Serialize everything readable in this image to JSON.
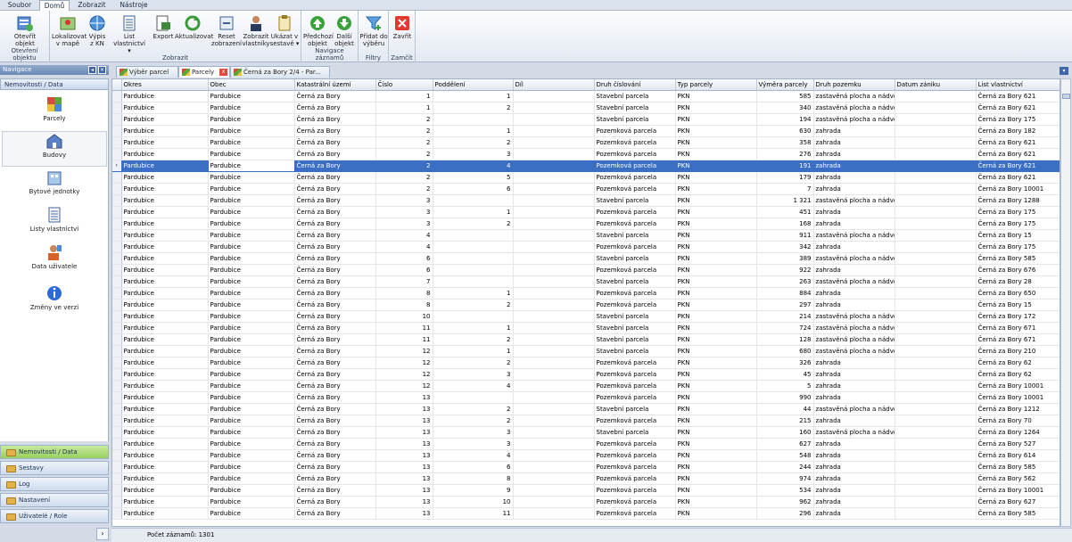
{
  "menu": {
    "tabs": [
      "Soubor",
      "Domů",
      "Zobrazit",
      "Nástroje"
    ],
    "active": 1
  },
  "ribbon": {
    "groups": [
      {
        "label": "Otevření objektu"
      },
      {
        "label": "Zobrazit"
      },
      {
        "label": "Navigace záznamů"
      },
      {
        "label": "Filtry"
      },
      {
        "label": "Zamčít"
      }
    ],
    "buttons": [
      {
        "line1": "Otevřít",
        "line2": "objekt",
        "icon": "open-object-icon"
      },
      {
        "line1": "Lokalizovat",
        "line2": "v mapě",
        "icon": "map-locate-icon"
      },
      {
        "line1": "Výpis",
        "line2": "z KN",
        "icon": "globe-icon"
      },
      {
        "line1": "List vlastnictví",
        "line2": "▾",
        "icon": "list-icon"
      },
      {
        "line1": "Export",
        "line2": "",
        "icon": "export-icon"
      },
      {
        "line1": "Aktualizovat",
        "line2": "",
        "icon": "refresh-icon"
      },
      {
        "line1": "Reset",
        "line2": "zobrazení",
        "icon": "reset-view-icon"
      },
      {
        "line1": "Zobrazit",
        "line2": "vlastníky",
        "icon": "owner-icon"
      },
      {
        "line1": "Ukázat v",
        "line2": "sestavě ▾",
        "icon": "report-icon"
      },
      {
        "line1": "Předchozí",
        "line2": "objekt",
        "icon": "arrow-up-icon"
      },
      {
        "line1": "Další",
        "line2": "objekt",
        "icon": "arrow-down-icon"
      },
      {
        "line1": "Přidat do",
        "line2": "výběru",
        "icon": "filter-add-icon"
      },
      {
        "line1": "Zavřít",
        "line2": "",
        "icon": "close-icon"
      }
    ]
  },
  "nav": {
    "header": "Navigace",
    "category": "Nemovitosti / Data",
    "items": [
      {
        "label": "Parcely",
        "icon": "parcel-icon"
      },
      {
        "label": "Budovy",
        "icon": "building-icon"
      },
      {
        "label": "Bytové jednotky",
        "icon": "apartment-icon"
      },
      {
        "label": "Listy vlastnictví",
        "icon": "ownership-list-icon"
      },
      {
        "label": "Data uživatele",
        "icon": "user-data-icon"
      },
      {
        "label": "Změny ve verzi",
        "icon": "info-icon"
      }
    ],
    "bars": [
      "Nemovitosti / Data",
      "Sestavy",
      "Log",
      "Nastavení",
      "Uživatelé / Role"
    ]
  },
  "tabs": [
    {
      "label": "Výběr parcel"
    },
    {
      "label": "Parcely"
    },
    {
      "label": "Černá za Bory 2/4 - Par..."
    }
  ],
  "grid": {
    "columns": [
      "Okres",
      "Obec",
      "Katastrální území",
      "Číslo",
      "Poddělení",
      "Díl",
      "Druh číslování",
      "Typ parcely",
      "Výměra parcely",
      "Druh pozemku",
      "Datum zániku",
      "List vlastnictví"
    ],
    "selected_row": 6,
    "rows": [
      [
        "Pardubice",
        "Pardubice",
        "Černá za Bory",
        "1",
        "1",
        "",
        "Stavební parcela",
        "PKN",
        "585",
        "zastavěná plocha a nádvoří",
        "",
        "Černá za Bory 621"
      ],
      [
        "Pardubice",
        "Pardubice",
        "Černá za Bory",
        "1",
        "2",
        "",
        "Stavební parcela",
        "PKN",
        "340",
        "zastavěná plocha a nádvoří",
        "",
        "Černá za Bory 621"
      ],
      [
        "Pardubice",
        "Pardubice",
        "Černá za Bory",
        "2",
        "",
        "",
        "Stavební parcela",
        "PKN",
        "194",
        "zastavěná plocha a nádvoří",
        "",
        "Černá za Bory 175"
      ],
      [
        "Pardubice",
        "Pardubice",
        "Černá za Bory",
        "2",
        "1",
        "",
        "Pozemková parcela",
        "PKN",
        "630",
        "zahrada",
        "",
        "Černá za Bory 182"
      ],
      [
        "Pardubice",
        "Pardubice",
        "Černá za Bory",
        "2",
        "2",
        "",
        "Pozemková parcela",
        "PKN",
        "358",
        "zahrada",
        "",
        "Černá za Bory 621"
      ],
      [
        "Pardubice",
        "Pardubice",
        "Černá za Bory",
        "2",
        "3",
        "",
        "Pozemková parcela",
        "PKN",
        "276",
        "zahrada",
        "",
        "Černá za Bory 621"
      ],
      [
        "Pardubice",
        "Pardubice",
        "Černá za Bory",
        "2",
        "4",
        "",
        "Pozemková parcela",
        "PKN",
        "191",
        "zahrada",
        "",
        "Černá za Bory 621"
      ],
      [
        "Pardubice",
        "Pardubice",
        "Černá za Bory",
        "2",
        "5",
        "",
        "Pozemková parcela",
        "PKN",
        "179",
        "zahrada",
        "",
        "Černá za Bory 621"
      ],
      [
        "Pardubice",
        "Pardubice",
        "Černá za Bory",
        "2",
        "6",
        "",
        "Pozemková parcela",
        "PKN",
        "7",
        "zahrada",
        "",
        "Černá za Bory 10001"
      ],
      [
        "Pardubice",
        "Pardubice",
        "Černá za Bory",
        "3",
        "",
        "",
        "Stavební parcela",
        "PKN",
        "1 321",
        "zastavěná plocha a nádvoří",
        "",
        "Černá za Bory 1288"
      ],
      [
        "Pardubice",
        "Pardubice",
        "Černá za Bory",
        "3",
        "1",
        "",
        "Pozemková parcela",
        "PKN",
        "451",
        "zahrada",
        "",
        "Černá za Bory 175"
      ],
      [
        "Pardubice",
        "Pardubice",
        "Černá za Bory",
        "3",
        "2",
        "",
        "Pozemková parcela",
        "PKN",
        "168",
        "zahrada",
        "",
        "Černá za Bory 175"
      ],
      [
        "Pardubice",
        "Pardubice",
        "Černá za Bory",
        "4",
        "",
        "",
        "Stavební parcela",
        "PKN",
        "911",
        "zastavěná plocha a nádvoří",
        "",
        "Černá za Bory 15"
      ],
      [
        "Pardubice",
        "Pardubice",
        "Černá za Bory",
        "4",
        "",
        "",
        "Pozemková parcela",
        "PKN",
        "342",
        "zahrada",
        "",
        "Černá za Bory 175"
      ],
      [
        "Pardubice",
        "Pardubice",
        "Černá za Bory",
        "6",
        "",
        "",
        "Stavební parcela",
        "PKN",
        "389",
        "zastavěná plocha a nádvoří",
        "",
        "Černá za Bory 585"
      ],
      [
        "Pardubice",
        "Pardubice",
        "Černá za Bory",
        "6",
        "",
        "",
        "Pozemková parcela",
        "PKN",
        "922",
        "zahrada",
        "",
        "Černá za Bory 676"
      ],
      [
        "Pardubice",
        "Pardubice",
        "Černá za Bory",
        "7",
        "",
        "",
        "Stavební parcela",
        "PKN",
        "263",
        "zastavěná plocha a nádvoří",
        "",
        "Černá za Bory 28"
      ],
      [
        "Pardubice",
        "Pardubice",
        "Černá za Bory",
        "8",
        "1",
        "",
        "Pozemková parcela",
        "PKN",
        "884",
        "zahrada",
        "",
        "Černá za Bory 650"
      ],
      [
        "Pardubice",
        "Pardubice",
        "Černá za Bory",
        "8",
        "2",
        "",
        "Pozemková parcela",
        "PKN",
        "297",
        "zahrada",
        "",
        "Černá za Bory 15"
      ],
      [
        "Pardubice",
        "Pardubice",
        "Černá za Bory",
        "10",
        "",
        "",
        "Stavební parcela",
        "PKN",
        "214",
        "zastavěná plocha a nádvoří",
        "",
        "Černá za Bory 172"
      ],
      [
        "Pardubice",
        "Pardubice",
        "Černá za Bory",
        "11",
        "1",
        "",
        "Stavební parcela",
        "PKN",
        "724",
        "zastavěná plocha a nádvoří",
        "",
        "Černá za Bory 671"
      ],
      [
        "Pardubice",
        "Pardubice",
        "Černá za Bory",
        "11",
        "2",
        "",
        "Stavební parcela",
        "PKN",
        "128",
        "zastavěná plocha a nádvoří",
        "",
        "Černá za Bory 671"
      ],
      [
        "Pardubice",
        "Pardubice",
        "Černá za Bory",
        "12",
        "1",
        "",
        "Stavební parcela",
        "PKN",
        "680",
        "zastavěná plocha a nádvoří",
        "",
        "Černá za Bory 210"
      ],
      [
        "Pardubice",
        "Pardubice",
        "Černá za Bory",
        "12",
        "2",
        "",
        "Pozemková parcela",
        "PKN",
        "326",
        "zahrada",
        "",
        "Černá za Bory 62"
      ],
      [
        "Pardubice",
        "Pardubice",
        "Černá za Bory",
        "12",
        "3",
        "",
        "Pozemková parcela",
        "PKN",
        "45",
        "zahrada",
        "",
        "Černá za Bory 62"
      ],
      [
        "Pardubice",
        "Pardubice",
        "Černá za Bory",
        "12",
        "4",
        "",
        "Pozemková parcela",
        "PKN",
        "5",
        "zahrada",
        "",
        "Černá za Bory 10001"
      ],
      [
        "Pardubice",
        "Pardubice",
        "Černá za Bory",
        "13",
        "",
        "",
        "Pozemková parcela",
        "PKN",
        "990",
        "zahrada",
        "",
        "Černá za Bory 10001"
      ],
      [
        "Pardubice",
        "Pardubice",
        "Černá za Bory",
        "13",
        "2",
        "",
        "Stavební parcela",
        "PKN",
        "44",
        "zastavěná plocha a nádvoří",
        "",
        "Černá za Bory 1212"
      ],
      [
        "Pardubice",
        "Pardubice",
        "Černá za Bory",
        "13",
        "2",
        "",
        "Pozemková parcela",
        "PKN",
        "215",
        "zahrada",
        "",
        "Černá za Bory 70"
      ],
      [
        "Pardubice",
        "Pardubice",
        "Černá za Bory",
        "13",
        "3",
        "",
        "Stavební parcela",
        "PKN",
        "160",
        "zastavěná plocha a nádvoří",
        "",
        "Černá za Bory 1264"
      ],
      [
        "Pardubice",
        "Pardubice",
        "Černá za Bory",
        "13",
        "3",
        "",
        "Pozemková parcela",
        "PKN",
        "627",
        "zahrada",
        "",
        "Černá za Bory 527"
      ],
      [
        "Pardubice",
        "Pardubice",
        "Černá za Bory",
        "13",
        "4",
        "",
        "Pozemková parcela",
        "PKN",
        "548",
        "zahrada",
        "",
        "Černá za Bory 614"
      ],
      [
        "Pardubice",
        "Pardubice",
        "Černá za Bory",
        "13",
        "6",
        "",
        "Pozemková parcela",
        "PKN",
        "244",
        "zahrada",
        "",
        "Černá za Bory 585"
      ],
      [
        "Pardubice",
        "Pardubice",
        "Černá za Bory",
        "13",
        "8",
        "",
        "Pozemková parcela",
        "PKN",
        "974",
        "zahrada",
        "",
        "Černá za Bory 562"
      ],
      [
        "Pardubice",
        "Pardubice",
        "Černá za Bory",
        "13",
        "9",
        "",
        "Pozemková parcela",
        "PKN",
        "534",
        "zahrada",
        "",
        "Černá za Bory 10001"
      ],
      [
        "Pardubice",
        "Pardubice",
        "Černá za Bory",
        "13",
        "10",
        "",
        "Pozemková parcela",
        "PKN",
        "962",
        "zahrada",
        "",
        "Černá za Bory 627"
      ],
      [
        "Pardubice",
        "Pardubice",
        "Černá za Bory",
        "13",
        "11",
        "",
        "Pozemková parcela",
        "PKN",
        "296",
        "zahrada",
        "",
        "Černá za Bory 585"
      ]
    ]
  },
  "status": {
    "record_count": "Počet záznamů: 1301"
  },
  "colors": {
    "selection": "#3a6fc4",
    "active_nav": "#98cf5e"
  }
}
